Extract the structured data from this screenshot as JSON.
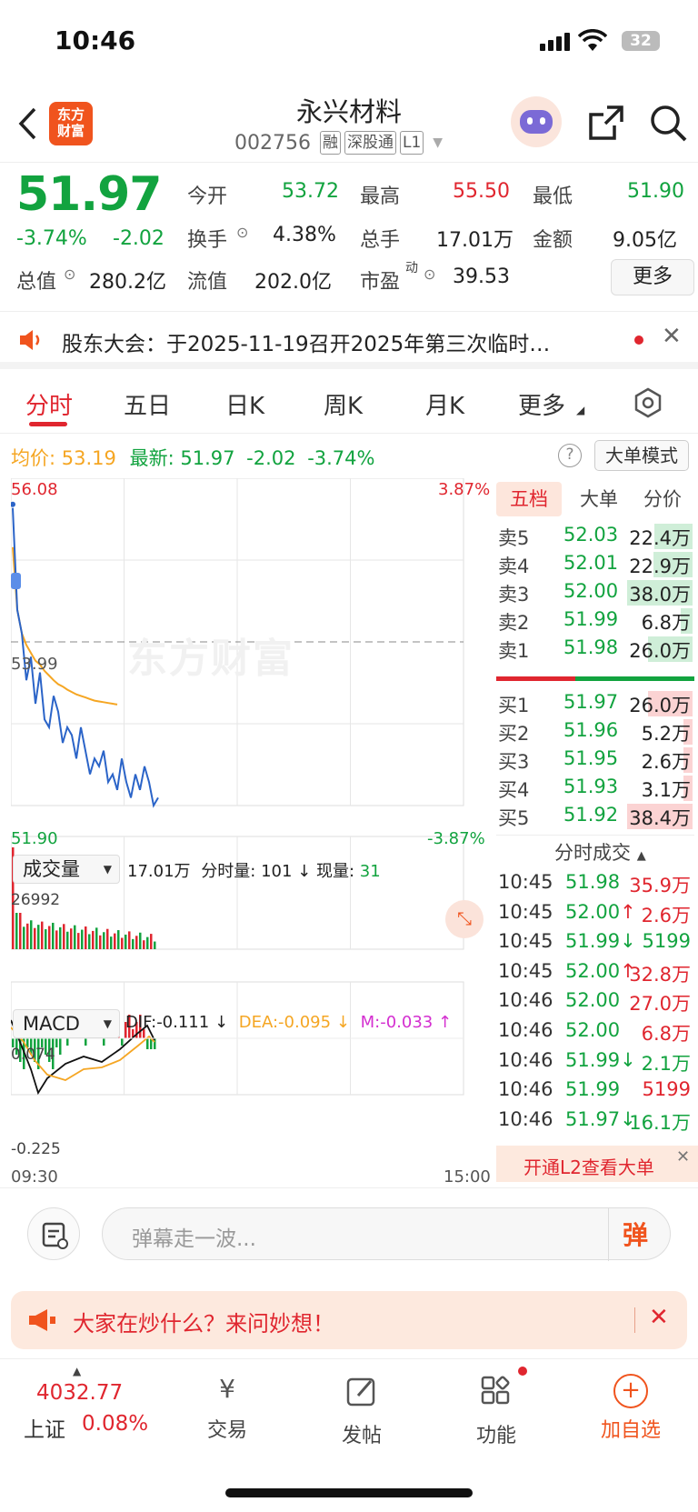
{
  "status": {
    "time": "10:46",
    "battery": "32"
  },
  "nav": {
    "title": "永兴材料",
    "code": "002756",
    "tags": [
      "融",
      "深股通",
      "L1"
    ],
    "logo_text": "东方\n财富"
  },
  "quote": {
    "price": "51.97",
    "change_pct": "-3.74%",
    "change": "-2.02",
    "open_label": "今开",
    "open": "53.72",
    "high_label": "最高",
    "high": "55.50",
    "low_label": "最低",
    "low": "51.90",
    "turnover_label": "换手",
    "turnover": "4.38%",
    "volume_label": "总手",
    "volume": "17.01万",
    "amount_label": "金额",
    "amount": "9.05亿",
    "mcap_label": "总值",
    "mcap": "280.2亿",
    "float_label": "流值",
    "float": "202.0亿",
    "pe_label": "市盈",
    "pe_sup": "动",
    "pe": "39.53",
    "more": "更多"
  },
  "notice": {
    "text": "股东大会：于2025-11-19召开2025年第三次临时…"
  },
  "tabs": [
    "分时",
    "五日",
    "日K",
    "周K",
    "月K",
    "更多"
  ],
  "info_line": {
    "avg_label": "均价:",
    "avg": "53.19",
    "latest_label": "最新:",
    "latest": "51.97",
    "change": "-2.02",
    "pct": "-3.74%",
    "mode": "大单模式"
  },
  "chart": {
    "y_max": "56.08",
    "y_max_pct": "3.87%",
    "y_mid": "53.99",
    "y_min": "51.90",
    "y_min_pct": "-3.87%",
    "watermark": "东方财富",
    "vol_label": "成交量",
    "vol_total": "17.01万",
    "vol_sub_label": "分时量:",
    "vol_sub": "101",
    "vol_now_label": "现量:",
    "vol_now": "31",
    "vol_max": "26992",
    "macd_label": "MACD",
    "dif": "DIF:-0.111",
    "dea": "DEA:-0.095",
    "m": "M:-0.033",
    "macd_max": "0.074",
    "macd_min": "-0.225",
    "time_start": "09:30",
    "time_end": "15:00"
  },
  "chart_data": {
    "type": "line",
    "price_axis": {
      "min": 51.9,
      "max": 56.08,
      "prev_close": 53.99
    },
    "price_series": [
      55.7,
      54.4,
      54.1,
      53.5,
      53.8,
      53.2,
      53.6,
      53.0,
      52.9,
      53.3,
      53.1,
      52.7,
      52.9,
      52.8,
      52.5,
      52.9,
      52.6,
      52.3,
      52.5,
      52.4,
      52.6,
      52.2,
      52.3,
      52.1,
      52.5,
      52.2,
      52.0,
      52.3,
      52.1,
      52.4,
      52.2,
      51.9,
      52.0
    ],
    "avg_series": [
      55.2,
      54.4,
      54.1,
      53.95,
      53.85,
      53.75,
      53.7,
      53.62,
      53.56,
      53.5,
      53.45,
      53.42,
      53.38,
      53.35,
      53.32,
      53.3,
      53.28,
      53.26,
      53.24,
      53.23,
      53.22,
      53.21,
      53.2,
      53.19
    ]
  },
  "orderbook": {
    "tabs": [
      "五档",
      "大单",
      "分价"
    ],
    "asks": [
      {
        "label": "卖5",
        "price": "52.03",
        "vol": "22.4万",
        "ratio": 0.58
      },
      {
        "label": "卖4",
        "price": "52.01",
        "vol": "22.9万",
        "ratio": 0.6
      },
      {
        "label": "卖3",
        "price": "52.00",
        "vol": "38.0万",
        "ratio": 1.0
      },
      {
        "label": "卖2",
        "price": "51.99",
        "vol": "6.8万",
        "ratio": 0.18
      },
      {
        "label": "卖1",
        "price": "51.98",
        "vol": "26.0万",
        "ratio": 0.68
      }
    ],
    "bids": [
      {
        "label": "买1",
        "price": "51.97",
        "vol": "26.0万",
        "ratio": 0.68
      },
      {
        "label": "买2",
        "price": "51.96",
        "vol": "5.2万",
        "ratio": 0.14
      },
      {
        "label": "买3",
        "price": "51.95",
        "vol": "2.6万",
        "ratio": 0.07
      },
      {
        "label": "买4",
        "price": "51.93",
        "vol": "3.1万",
        "ratio": 0.08
      },
      {
        "label": "买5",
        "price": "51.92",
        "vol": "38.4万",
        "ratio": 1.0
      }
    ],
    "trades_title": "分时成交",
    "trades": [
      {
        "t": "10:45",
        "p": "51.98",
        "arrow": "",
        "v": "35.9万",
        "vc": "red"
      },
      {
        "t": "10:45",
        "p": "52.00",
        "arrow": "↑",
        "v": "2.6万",
        "vc": "red"
      },
      {
        "t": "10:45",
        "p": "51.99",
        "arrow": "↓",
        "v": "5199",
        "vc": "green"
      },
      {
        "t": "10:45",
        "p": "52.00",
        "arrow": "↑",
        "v": "32.8万",
        "vc": "red"
      },
      {
        "t": "10:46",
        "p": "52.00",
        "arrow": "",
        "v": "27.0万",
        "vc": "red"
      },
      {
        "t": "10:46",
        "p": "52.00",
        "arrow": "",
        "v": "6.8万",
        "vc": "red"
      },
      {
        "t": "10:46",
        "p": "51.99",
        "arrow": "↓",
        "v": "2.1万",
        "vc": "green"
      },
      {
        "t": "10:46",
        "p": "51.99",
        "arrow": "",
        "v": "5199",
        "vc": "red"
      },
      {
        "t": "10:46",
        "p": "51.97",
        "arrow": "↓",
        "v": "16.1万",
        "vc": "green"
      }
    ],
    "l2": "开通L2查看大单"
  },
  "danmaku": {
    "placeholder": "弹幕走一波...",
    "send": "弹"
  },
  "banner": {
    "text": "大家在炒什么？来问妙想！"
  },
  "bottom": {
    "index_value": "4032.77",
    "index_name": "上证",
    "index_pct": "0.08%",
    "trade": "交易",
    "post": "发帖",
    "func": "功能",
    "add": "加自选"
  },
  "colors": {
    "red": "#e0262f",
    "green": "#12a33f",
    "orange": "#f5a623",
    "blue": "#2b64c8"
  }
}
